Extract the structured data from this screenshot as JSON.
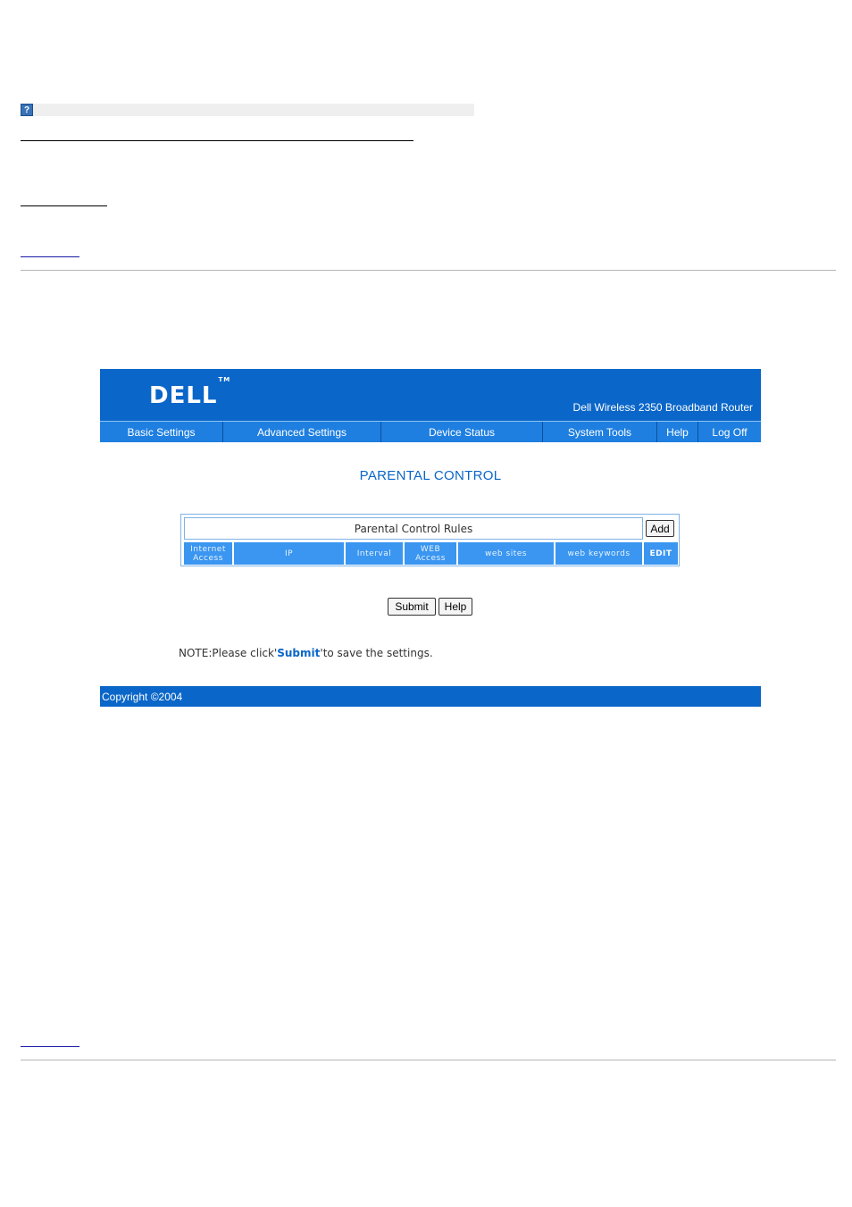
{
  "help_icon": {
    "glyph": "?",
    "icon": "help-icon"
  },
  "router_ui": {
    "logo": "DELL",
    "logo_tm": "TM",
    "product_name": "Dell Wireless 2350 Broadband Router",
    "nav": [
      "Basic Settings",
      "Advanced Settings",
      "Device Status",
      "System Tools",
      "Help",
      "Log Off"
    ],
    "page_title": "PARENTAL CONTROL",
    "rules_table": {
      "title": "Parental Control Rules",
      "add_label": "Add",
      "columns": [
        {
          "label": "Internet Access"
        },
        {
          "label": "IP"
        },
        {
          "label": "Interval"
        },
        {
          "label": "WEB Access"
        },
        {
          "label": "web sites"
        },
        {
          "label": "web keywords"
        },
        {
          "label": "EDIT"
        }
      ]
    },
    "submit_label": "Submit",
    "help_label": "Help",
    "note_prefix": "NOTE:Please click'",
    "note_link": "Submit",
    "note_suffix": "'to save the settings.",
    "copyright": "Copyright ©2004"
  },
  "colors": {
    "banner": "#0a66c8",
    "nav": "#1e7fe0",
    "column_header": "#3a96f0"
  }
}
